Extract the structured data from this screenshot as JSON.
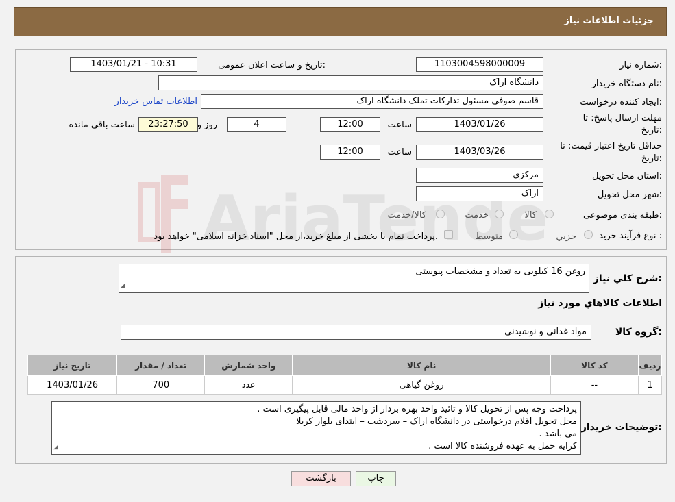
{
  "header": {
    "title": "جزئیات اطلاعات نیاز"
  },
  "form": {
    "need_number_label": "شماره نیاز:",
    "need_number_value": "1103004598000009",
    "announce_label": "تاریخ و ساعت اعلان عمومی:",
    "announce_value": "1403/01/21 - 10:31",
    "buyer_org_label": "نام دستگاه خریدار:",
    "buyer_org_value": "دانشگاه اراک",
    "creator_label": "ایجاد کننده درخواست:",
    "creator_value": "قاسم صوفی مسئول تدارکات تملک دانشگاه اراک",
    "contact_link": "اطلاعات تماس خریدار",
    "deadline_label_1": "مهلت ارسال پاسخ: تا",
    "deadline_label_2": "تاریخ:",
    "deadline_date": "1403/01/26",
    "time_label": "ساعت",
    "deadline_time": "12:00",
    "days_value": "4",
    "days_label": "روز و",
    "remaining_time": "23:27:50",
    "remaining_label": "ساعت باقي مانده",
    "validity_label_1": "حداقل تاریخ اعتبار قیمت: تا",
    "validity_label_2": "تاریخ:",
    "validity_date": "1403/03/26",
    "validity_time": "12:00",
    "province_label": "استان محل تحویل:",
    "province_value": "مرکزی",
    "city_label": "شهر محل تحویل:",
    "city_value": "اراک",
    "category_label": "طبقه بندی موضوعی:",
    "category_options": [
      "کالا",
      "خدمت",
      "کالا/خدمت"
    ],
    "process_label": "نوع فرآیند خرید :",
    "process_options": [
      "جزيي",
      "متوسط"
    ],
    "payment_note": "پرداخت تمام یا بخشی از مبلغ خرید،از محل \"اسناد خزانه اسلامی\" خواهد بود."
  },
  "details": {
    "summary_label": "شرح كلي نياز:",
    "summary_value": "روغن 16 کیلویی به تعداد و مشخصات پیوستی",
    "goods_heading": "اطلاعات كالاهاي مورد نياز",
    "group_label": "گروه كالا:",
    "group_value": "مواد غذائی و نوشیدنی",
    "table": {
      "headers": [
        "رديف",
        "كد كالا",
        "نام كالا",
        "واحد شمارش",
        "تعداد / مقدار",
        "تاريخ نياز"
      ],
      "rows": [
        [
          "1",
          "--",
          "روغن گیاهی",
          "عدد",
          "700",
          "1403/01/26"
        ]
      ]
    },
    "buyer_notes_label": "توضيحات خريدار:",
    "buyer_notes_lines": [
      "پرداخت وجه پس از تحویل کالا و تائید واحد بهره بردار از واحد مالی قابل پیگیری است .",
      "محل تحویل اقلام درخواستی در دانشگاه اراک – سردشت – ابتدای بلوار کربلا",
      "می باشد .",
      "کرایه حمل به عهده فروشنده کالا است ."
    ]
  },
  "buttons": {
    "print": "چاپ",
    "back": "بازگشت"
  },
  "colors": {
    "header": "#8b6a43",
    "back_button": "#f8dede",
    "print_button": "#eaf7e4",
    "remaining_bg": "#fdfbd7",
    "link": "#1a44c8"
  }
}
